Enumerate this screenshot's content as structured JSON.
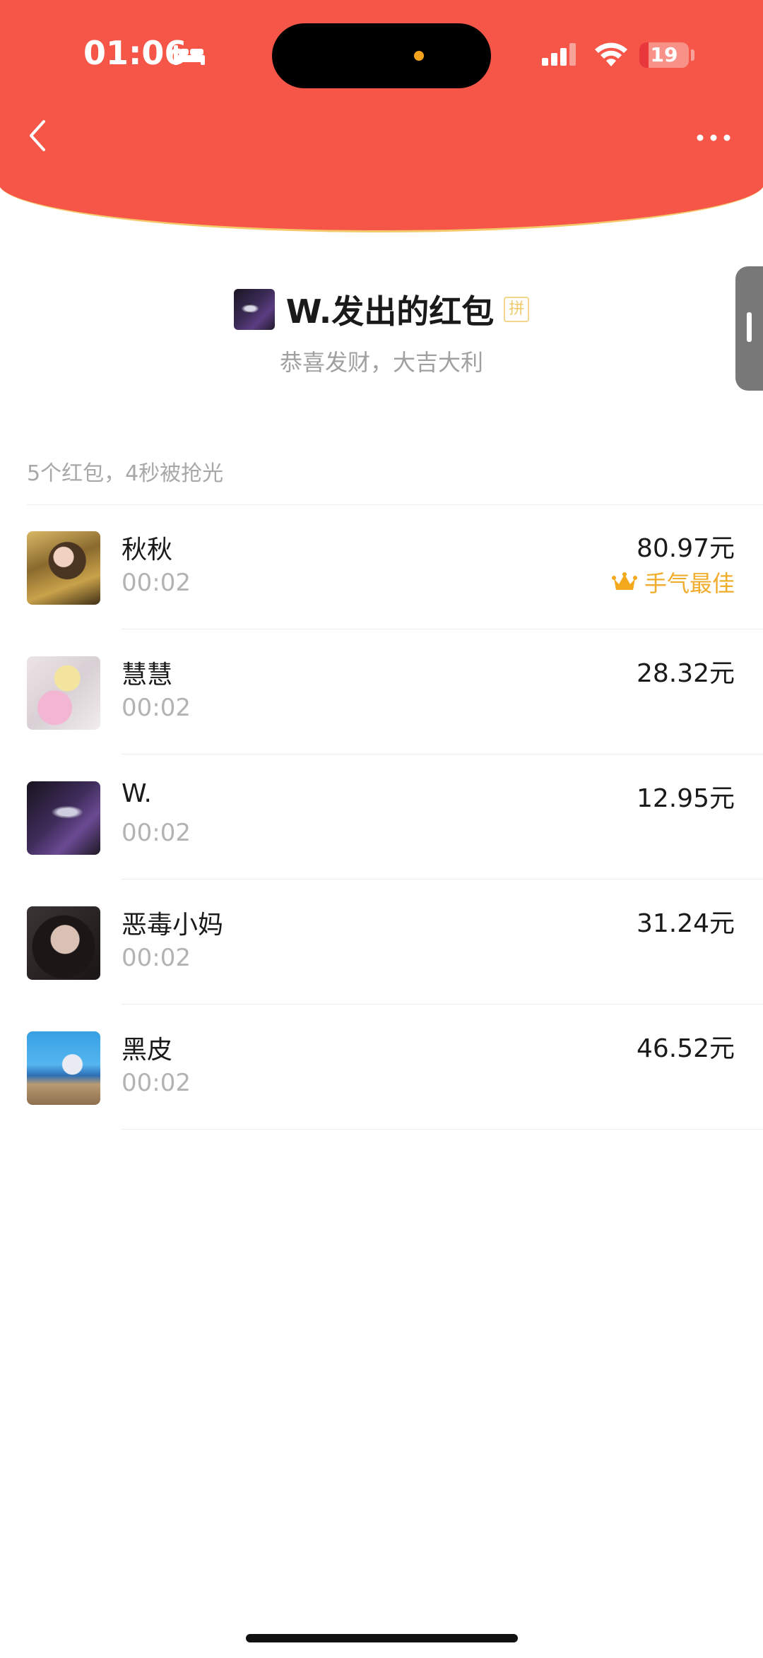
{
  "status_bar": {
    "time": "01:06",
    "battery": "19",
    "battery_level": 0.19,
    "icons": [
      "bed-icon",
      "signal-icon",
      "wifi-icon",
      "battery-icon"
    ]
  },
  "nav": {
    "icons": [
      "chevron-left-icon",
      "more-icon"
    ]
  },
  "header": {
    "title": "W.发出的红包",
    "tag": "拼",
    "wish": "恭喜发财，大吉大利"
  },
  "summary": "5个红包，4秒被抢光",
  "receivers": [
    {
      "name": "秋秋",
      "time": "00:02",
      "amount": "80.97元",
      "best": "手气最佳"
    },
    {
      "name": "慧慧",
      "time": "00:02",
      "amount": "28.32元"
    },
    {
      "name": "W.",
      "time": "00:02",
      "amount": "12.95元"
    },
    {
      "name": "恶毒小妈",
      "time": "00:02",
      "amount": "31.24元"
    },
    {
      "name": "黑皮",
      "time": "00:02",
      "amount": "46.52元"
    }
  ],
  "colors": {
    "header_red": "#f55647",
    "gold": "#f0ac2b",
    "divider": "#ececec"
  }
}
